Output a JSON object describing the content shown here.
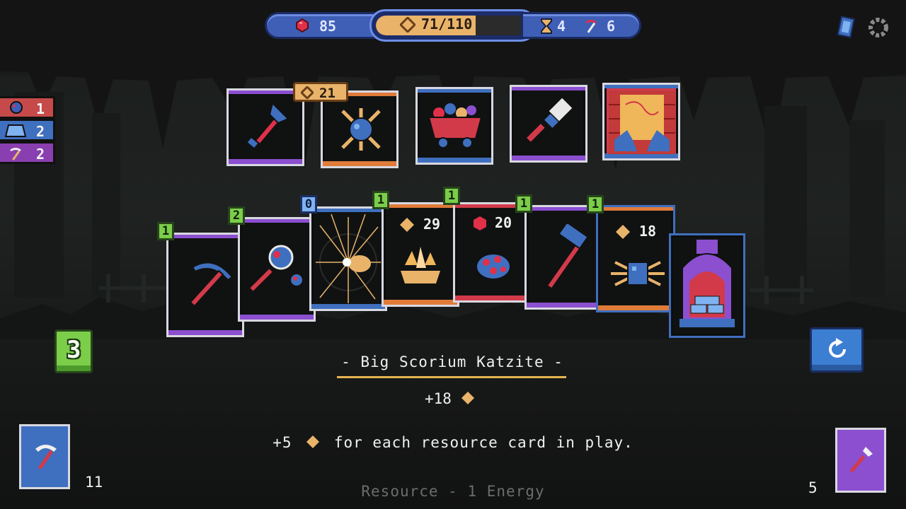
{
  "hud": {
    "rubies": "85",
    "energy_text": "71/110",
    "energy_fraction": 0.645,
    "hourglass": "4",
    "pickaxes": "6"
  },
  "counters": [
    {
      "icon": "ore-icon",
      "value": "1",
      "color": "#c64a4a"
    },
    {
      "icon": "ingot-icon",
      "value": "2",
      "color": "#3f6fbf"
    },
    {
      "icon": "pickaxe-icon",
      "value": "2",
      "color": "#8a3fb0"
    }
  ],
  "shop": {
    "price": "21",
    "cards": [
      {
        "name": "shovel-card",
        "icon": "shovel-icon",
        "band": "#8b4fd0"
      },
      {
        "name": "spiked-ore-card",
        "icon": "spiked-ore-icon",
        "band": "#e07b39"
      },
      {
        "name": "ore-cart-card",
        "icon": "minecart-icon",
        "band": "#3f6fbf"
      },
      {
        "name": "brush-card",
        "icon": "brush-icon",
        "band": "#8b4fd0"
      },
      {
        "name": "map-card",
        "icon": "treasure-map-icon",
        "band": "#3f6fbf"
      }
    ]
  },
  "hand": [
    {
      "name": "pickaxe-card",
      "cost": "1",
      "icon": "pickaxe-icon"
    },
    {
      "name": "magnifier-card",
      "cost": "2",
      "icon": "magnifier-icon"
    },
    {
      "name": "burst-card",
      "cost": "0",
      "icon": "burst-icon"
    },
    {
      "name": "crystal-card",
      "cost": "1",
      "value": "29",
      "icon": "crystal-icon"
    },
    {
      "name": "ruby-ore-card",
      "cost": "1",
      "value": "20",
      "icon": "ruby-ore-icon"
    },
    {
      "name": "hammer-card",
      "cost": "1",
      "icon": "hammer-icon"
    },
    {
      "name": "scorium-card",
      "cost": "1",
      "value": "18",
      "icon": "scorium-icon"
    },
    {
      "name": "furnace-card",
      "icon": "furnace-icon"
    }
  ],
  "description": {
    "title": "- Big Scorium Katzite -",
    "bonus": "+18",
    "text_before": "+5",
    "text_after": "for each resource card in play.",
    "type_line": "Resource - 1 Energy"
  },
  "turns_left": "3",
  "draw_pile_count": "11",
  "discard_pile_count": "5",
  "colors": {
    "gold": "#e9b36a",
    "blue": "#3f5fb6",
    "green": "#7ccd4a",
    "purple": "#8b4fd0",
    "orange": "#e07b39",
    "red": "#d23a4a"
  }
}
